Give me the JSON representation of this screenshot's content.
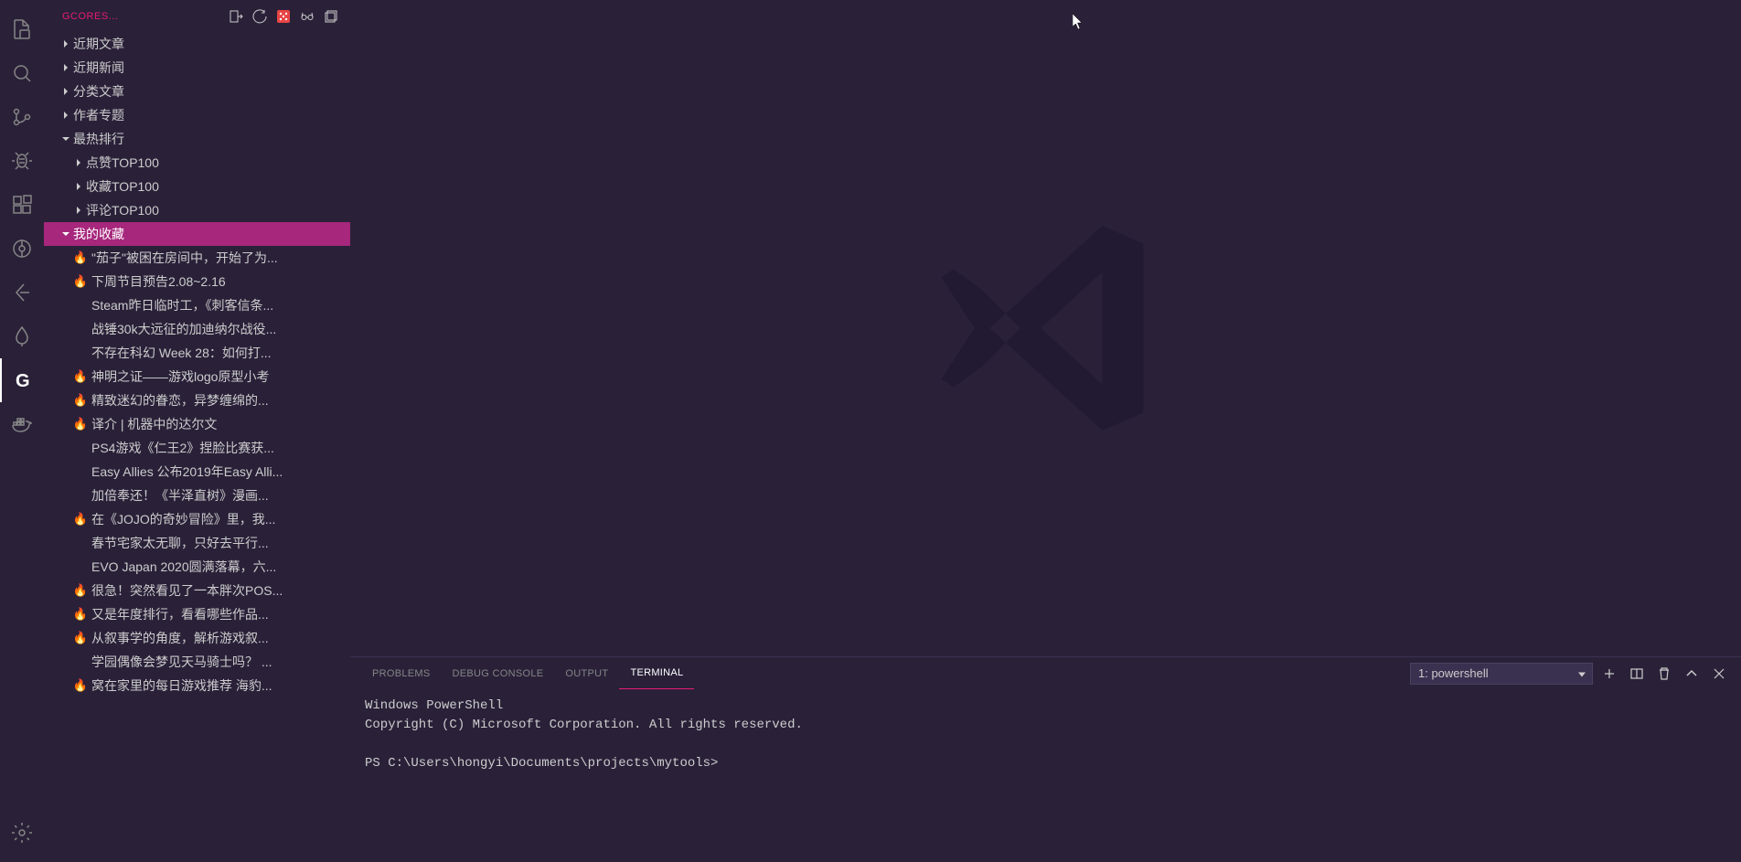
{
  "sidebar": {
    "title": "GCORES...",
    "sections": [
      {
        "label": "近期文章",
        "expanded": false,
        "indent": 1
      },
      {
        "label": "近期新闻",
        "expanded": false,
        "indent": 1
      },
      {
        "label": "分类文章",
        "expanded": false,
        "indent": 1
      },
      {
        "label": "作者专题",
        "expanded": false,
        "indent": 1
      },
      {
        "label": "最热排行",
        "expanded": true,
        "indent": 1,
        "children": [
          {
            "label": "点赞TOP100",
            "expanded": false,
            "indent": 2
          },
          {
            "label": "收藏TOP100",
            "expanded": false,
            "indent": 2
          },
          {
            "label": "评论TOP100",
            "expanded": false,
            "indent": 2
          }
        ]
      },
      {
        "label": "我的收藏",
        "expanded": true,
        "selected": true,
        "indent": 1
      }
    ],
    "favorites": [
      {
        "hot": true,
        "label": "\"茄子\"被困在房间中，开始了为..."
      },
      {
        "hot": true,
        "label": "下周节目预告2.08~2.16"
      },
      {
        "hot": false,
        "label": "Steam昨日临时工，《刺客信条..."
      },
      {
        "hot": false,
        "label": "战锤30k大远征的加迪纳尔战役..."
      },
      {
        "hot": false,
        "label": "不存在科幻 Week 28：如何打..."
      },
      {
        "hot": true,
        "label": "神明之证——游戏logo原型小考"
      },
      {
        "hot": true,
        "label": "精致迷幻的眷恋，异梦缠绵的..."
      },
      {
        "hot": true,
        "label": "译介 | 机器中的达尔文"
      },
      {
        "hot": false,
        "label": "PS4游戏《仁王2》捏脸比赛获..."
      },
      {
        "hot": false,
        "label": "Easy Allies 公布2019年Easy Alli..."
      },
      {
        "hot": false,
        "label": "加倍奉还！《半泽直树》漫画..."
      },
      {
        "hot": true,
        "label": "在《JOJO的奇妙冒险》里，我..."
      },
      {
        "hot": false,
        "label": "春节宅家太无聊，只好去平行..."
      },
      {
        "hot": false,
        "label": "EVO Japan 2020圆满落幕，六..."
      },
      {
        "hot": true,
        "label": "很急！突然看见了一本胖次POS..."
      },
      {
        "hot": true,
        "label": "又是年度排行，看看哪些作品..."
      },
      {
        "hot": true,
        "label": "从叙事学的角度，解析游戏叙..."
      },
      {
        "hot": false,
        "label": "学园偶像会梦见天马骑士吗？ ..."
      },
      {
        "hot": true,
        "label": "窝在家里的每日游戏推荐 海豹..."
      }
    ]
  },
  "panel": {
    "tabs": [
      "PROBLEMS",
      "DEBUG CONSOLE",
      "OUTPUT",
      "TERMINAL"
    ],
    "activeTab": "TERMINAL",
    "terminalSelect": "1: powershell",
    "terminalLines": [
      "Windows PowerShell",
      "Copyright (C) Microsoft Corporation. All rights reserved.",
      "",
      "PS C:\\Users\\hongyi\\Documents\\projects\\mytools>"
    ]
  }
}
